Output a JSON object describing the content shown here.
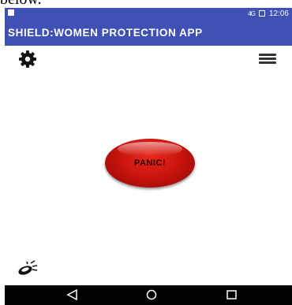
{
  "caption_fragment": "below.",
  "status_bar": {
    "signal_label": "4G",
    "time": "12:06"
  },
  "app_bar": {
    "title": "SHIELD:WOMEN PROTECTION APP"
  },
  "toolbar": {
    "settings_icon": "gear-icon",
    "menu_icon": "hamburger-menu-icon"
  },
  "main": {
    "panic_button_label": "PANIC!"
  },
  "footer": {
    "sensor_icon": "shake-sensor-icon"
  },
  "nav_bar": {
    "back_icon": "back-triangle-icon",
    "home_icon": "home-circle-icon",
    "recents_icon": "recents-square-icon"
  },
  "colors": {
    "app_bar": "#3f51b5",
    "panic_button": "#c8140d",
    "nav_bar": "#000000"
  }
}
